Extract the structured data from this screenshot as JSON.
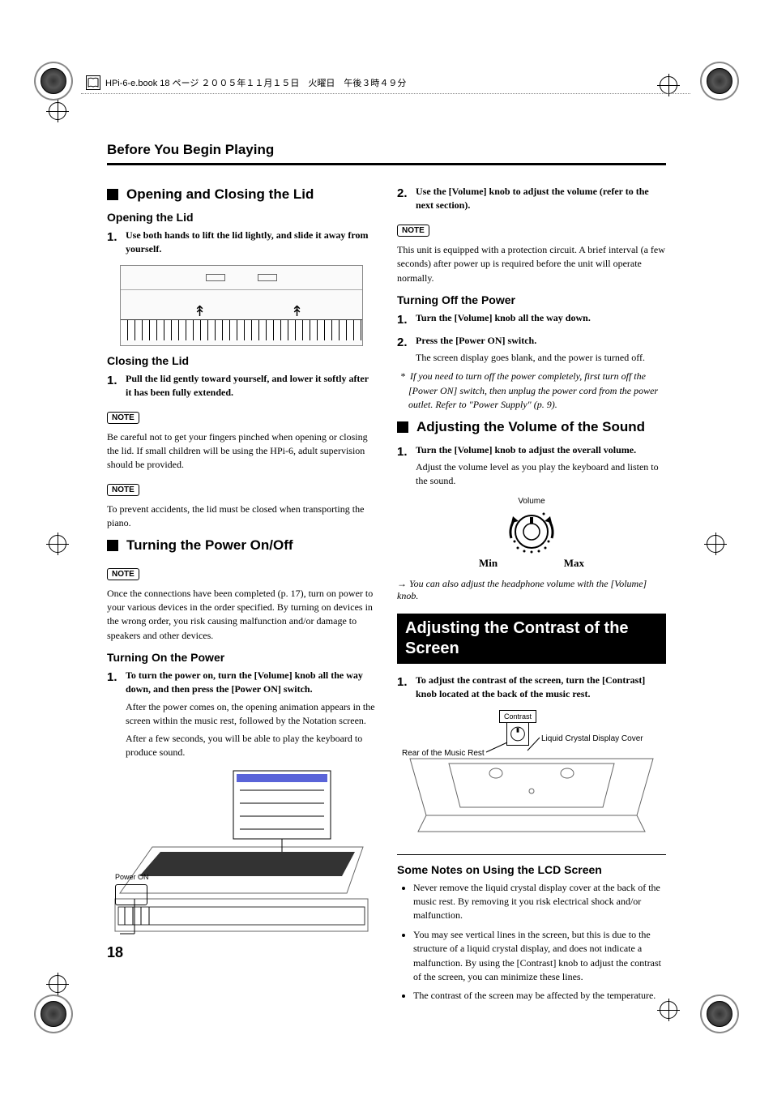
{
  "header": {
    "text": "HPi-6-e.book  18 ページ  ２００５年１１月１５日　火曜日　午後３時４９分"
  },
  "runningHead": "Before You Begin Playing",
  "pageNumber": "18",
  "left": {
    "sect1": {
      "title": "Opening and Closing the Lid",
      "sub1": "Opening the Lid",
      "step1": "Use both hands to lift the lid lightly, and slide it away from yourself.",
      "sub2": "Closing the Lid",
      "step2": "Pull the lid gently toward yourself, and lower it softly after it has been fully extended.",
      "note1": "Be careful not to get your fingers pinched when opening or closing the lid. If small children will be using the HPi-6, adult supervision should be provided.",
      "note2": "To prevent accidents, the lid must be closed when transporting the piano."
    },
    "sect2": {
      "title": "Turning the Power On/Off",
      "note": "Once the connections have been completed (p. 17), turn on power to your various devices in the order specified. By turning on devices in the wrong order, you risk causing malfunction and/or damage to speakers and other devices.",
      "sub1": "Turning On the Power",
      "step1": "To turn the power on, turn the [Volume] knob all the way down, and then press the [Power ON] switch.",
      "step1cont1": "After the power comes on, the opening animation appears in the screen within the music rest, followed by the Notation screen.",
      "step1cont2": "After a few seconds, you will be able to play the keyboard to produce sound.",
      "figLabel": "Power ON"
    }
  },
  "right": {
    "step2": "Use the [Volume] knob to adjust the volume (refer to the next section).",
    "note1": "This unit is equipped with a protection circuit. A brief interval (a few seconds) after power up is required before the unit will operate normally.",
    "sub2": "Turning Off the Power",
    "off_step1": "Turn the [Volume] knob all the way down.",
    "off_step2": "Press the [Power ON] switch.",
    "off_cont": "The screen display goes blank, and the power is turned off.",
    "off_ital": "If you need to turn off the power completely, first turn off the [Power ON] switch, then unplug the power cord from the power outlet. Refer to \"Power Supply\" (p. 9).",
    "sect3": {
      "title": "Adjusting the Volume of the Sound",
      "step1": "Turn the [Volume] knob to adjust the overall volume.",
      "cont": "Adjust the volume level as you play the keyboard and listen to the sound.",
      "figTop": "Volume",
      "figMin": "Min",
      "figMax": "Max",
      "arrow": "→  You can also adjust the headphone volume with the [Volume] knob."
    },
    "sect4": {
      "title": "Adjusting the Contrast of the Screen",
      "step1": "To adjust the contrast of the screen, turn the [Contrast] knob located at the back of the music rest.",
      "figLeft": "Rear of the Music Rest",
      "figKnob": "Contrast",
      "figRight": "Liquid Crystal Display Cover"
    },
    "sect5": {
      "title": "Some Notes on Using the LCD Screen",
      "b1": "Never remove the liquid crystal display cover at the back of the music rest. By removing it you risk electrical shock and/or malfunction.",
      "b2": "You may see vertical lines in the screen, but this is due to the structure of a liquid crystal display, and does not indicate a malfunction. By using the [Contrast] knob to adjust the contrast of the screen, you can minimize these lines.",
      "b3": "The contrast of the screen may be affected by the temperature."
    }
  },
  "noteLabel": "NOTE",
  "asterisk": "*"
}
